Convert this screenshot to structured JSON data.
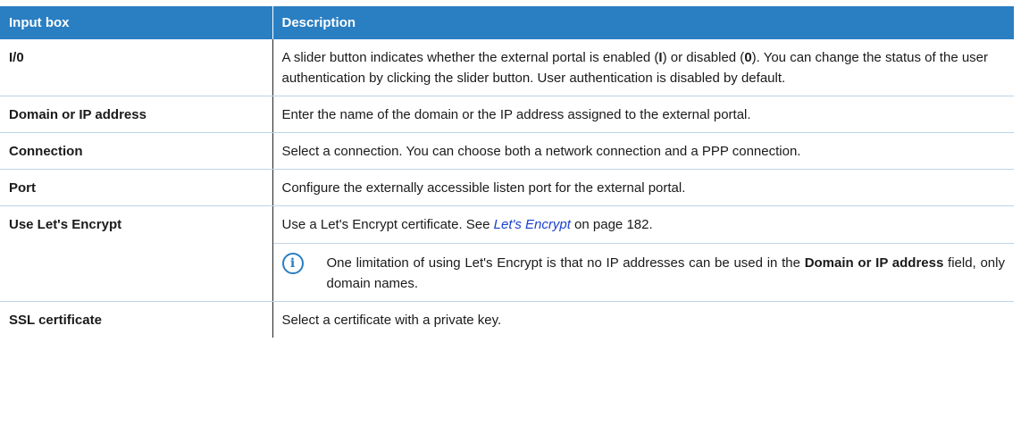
{
  "header": {
    "col1": "Input box",
    "col2": "Description"
  },
  "rows": [
    {
      "name": "I/0",
      "desc_parts": [
        "A slider button indicates whether the external portal is enabled (",
        "I",
        ") or disabled (",
        "0",
        "). You can change the status of the user authentication by clicking the slider button. User authentication is disabled by default."
      ]
    },
    {
      "name": "Domain or IP address",
      "desc": "Enter the name of the domain or the IP address assigned to the external portal."
    },
    {
      "name": "Connection",
      "desc": "Select a connection. You can choose both a network connection and a PPP connection."
    },
    {
      "name": "Port",
      "desc": "Configure the externally accessible listen port for the external portal."
    },
    {
      "name": "Use Let's Encrypt",
      "desc_prefix": "Use a Let's Encrypt certificate. See ",
      "link_text": "Let's Encrypt",
      "desc_suffix": " on page 182.",
      "note_parts": [
        "One limitation of using Let's Encrypt is that no IP addresses can be used in the ",
        "Domain or IP address",
        " field, only domain names."
      ],
      "note_icon": "info-icon"
    },
    {
      "name": "SSL certificate",
      "desc": "Select a certificate with a private key."
    }
  ]
}
